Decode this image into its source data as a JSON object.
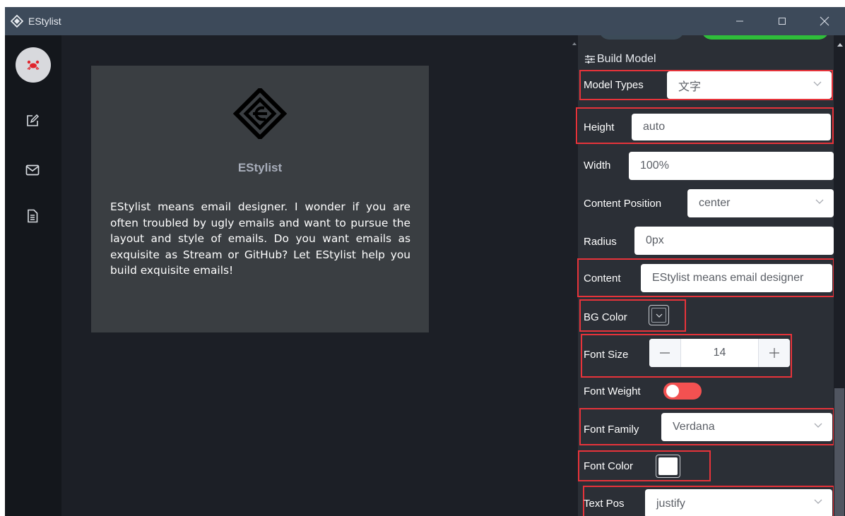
{
  "window": {
    "title": "EStylist",
    "controls": {
      "minimize": "minimize-icon",
      "maximize": "maximize-icon",
      "close": "close-icon"
    }
  },
  "sidebar": {
    "items": [
      {
        "icon": "crab-avatar-icon",
        "active": true
      },
      {
        "icon": "edit-icon"
      },
      {
        "icon": "mail-icon"
      },
      {
        "icon": "document-icon"
      }
    ]
  },
  "preview": {
    "logo": "estylist-logo",
    "title": "EStylist",
    "text": "EStylist means email designer. I wonder if you are often troubled by ugly emails and want to pursue the layout and style of emails. Do you want emails as exquisite as Stream or GitHub? Let EStylist help you build exquisite emails!"
  },
  "panel": {
    "section_title": "Build Model",
    "fields": {
      "model_types": {
        "label": "Model Types",
        "value": "文字"
      },
      "height": {
        "label": "Height",
        "value": "auto"
      },
      "width": {
        "label": "Width",
        "value": "100%"
      },
      "content_position": {
        "label": "Content Position",
        "value": "center"
      },
      "radius": {
        "label": "Radius",
        "value": "0px"
      },
      "content": {
        "label": "Content",
        "value": "EStylist means email designer"
      },
      "bg_color": {
        "label": "BG Color"
      },
      "font_size": {
        "label": "Font Size",
        "value": "14"
      },
      "font_weight": {
        "label": "Font Weight",
        "on": true
      },
      "font_family": {
        "label": "Font Family",
        "value": "Verdana"
      },
      "font_color": {
        "label": "Font Color",
        "value": "#ffffff"
      },
      "text_pos": {
        "label": "Text Pos",
        "value": "justify"
      }
    }
  },
  "colors": {
    "titlebar": "#3d4a5a",
    "sidebar": "#14171c",
    "canvas": "#1c1f26",
    "card": "#3a3e42",
    "panel": "#2b2f36",
    "highlight": "#e7333a",
    "toggle_on": "#f35151",
    "top_button_green": "#2fbe3a"
  }
}
